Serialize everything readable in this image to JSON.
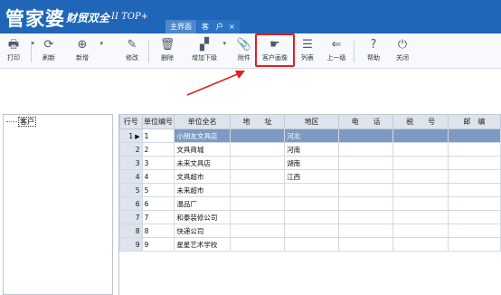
{
  "app": {
    "brand_main": "管家婆",
    "brand_sub": "财贸双全",
    "brand_version": "II TOP+"
  },
  "tabs": [
    {
      "label": "主界面",
      "closable": false
    },
    {
      "label": "客　户",
      "closable": true,
      "close_glyph": "×"
    }
  ],
  "toolbar": {
    "print": "打印",
    "refresh": "刷新",
    "add": "新增",
    "edit": "修改",
    "delete": "删除",
    "add_child": "增加下级",
    "attachment": "附件",
    "customer_profile": "客户画像",
    "list": "列表",
    "up_level": "上一级",
    "help": "帮助",
    "close": "关闭"
  },
  "tree": {
    "root_label": "客户"
  },
  "table": {
    "columns": [
      "行号",
      "单位编号",
      "单位全名",
      "地　　址",
      "地区",
      "电　　话",
      "税　　号",
      "邮　编"
    ],
    "rows": [
      {
        "row": "1",
        "code": "1",
        "name": "小朋友文具店",
        "address": "",
        "region": "河北",
        "phone": "",
        "tax": "",
        "zip": ""
      },
      {
        "row": "2",
        "code": "2",
        "name": "文具商城",
        "address": "",
        "region": "河南",
        "phone": "",
        "tax": "",
        "zip": ""
      },
      {
        "row": "3",
        "code": "3",
        "name": "未来文具店",
        "address": "",
        "region": "湖南",
        "phone": "",
        "tax": "",
        "zip": ""
      },
      {
        "row": "4",
        "code": "4",
        "name": "文具超市",
        "address": "",
        "region": "江西",
        "phone": "",
        "tax": "",
        "zip": ""
      },
      {
        "row": "5",
        "code": "5",
        "name": "未来超市",
        "address": "",
        "region": "",
        "phone": "",
        "tax": "",
        "zip": ""
      },
      {
        "row": "6",
        "code": "6",
        "name": "温品厂",
        "address": "",
        "region": "",
        "phone": "",
        "tax": "",
        "zip": ""
      },
      {
        "row": "7",
        "code": "7",
        "name": "和泰装修公司",
        "address": "",
        "region": "",
        "phone": "",
        "tax": "",
        "zip": ""
      },
      {
        "row": "8",
        "code": "8",
        "name": "快递公司",
        "address": "",
        "region": "",
        "phone": "",
        "tax": "",
        "zip": ""
      },
      {
        "row": "9",
        "code": "9",
        "name": "星星艺术学校",
        "address": "",
        "region": "",
        "phone": "",
        "tax": "",
        "zip": ""
      }
    ],
    "selected_row_index": 0,
    "pointer_glyph": "▶"
  },
  "colors": {
    "header_bg": "#1f66b8",
    "highlight": "#e0201e",
    "selection": "#7d9bc2"
  }
}
